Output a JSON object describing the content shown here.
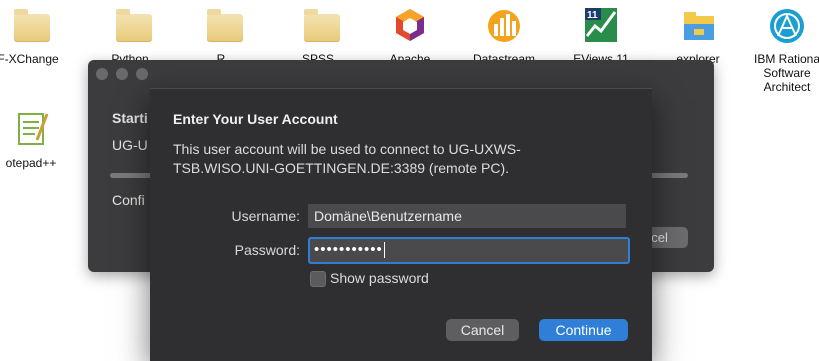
{
  "desktop": {
    "icons": [
      {
        "label": "F-XChange",
        "icon": "folder-icon"
      },
      {
        "label": "Python",
        "icon": "folder-icon"
      },
      {
        "label": "R",
        "icon": "folder-icon"
      },
      {
        "label": "SPSS",
        "icon": "folder-icon"
      },
      {
        "label": "Apache",
        "icon": "apache-icon"
      },
      {
        "label": "Datastream",
        "icon": "datastream-icon"
      },
      {
        "label": "EViews 11",
        "icon": "eviews-icon",
        "badge": "11"
      },
      {
        "label": "explorer",
        "icon": "explorer-icon"
      },
      {
        "label": "IBM Rational Software Architect",
        "line1": "IBM Rationa",
        "line2": "Software",
        "line3": "Architect",
        "icon": "ibm-rational-icon"
      },
      {
        "label": "otepad++",
        "icon": "notepad-plus-plus-icon"
      }
    ]
  },
  "background_window": {
    "title_line": "Starti",
    "subtitle_line": "UG-U",
    "status_line": "Confi",
    "button_label": "ncel"
  },
  "dialog": {
    "title": "Enter Your User Account",
    "message": "This user account will be used to connect to UG-UXWS-TSB.WISO.UNI-GOETTINGEN.DE:3389 (remote PC).",
    "username_label": "Username:",
    "username_value": "Domäne\\Benutzername",
    "password_label": "Password:",
    "password_masked": "•••••••••••",
    "show_password_label": "Show password",
    "show_password_checked": false,
    "cancel_label": "Cancel",
    "continue_label": "Continue"
  },
  "colors": {
    "accent": "#2f7fd8",
    "dialog_bg": "#2f2f31",
    "window_bg": "#3c3c3e",
    "folder": "#e8c979"
  }
}
